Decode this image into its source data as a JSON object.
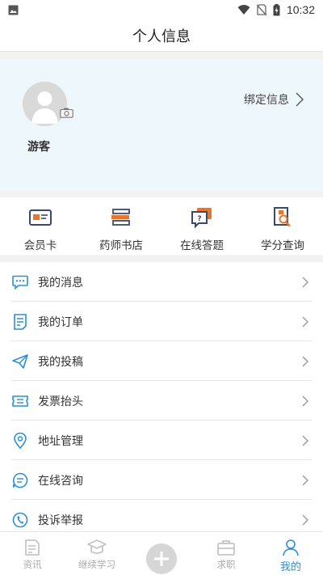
{
  "status_bar": {
    "time": "10:32"
  },
  "header": {
    "title": "个人信息"
  },
  "profile": {
    "name": "游客",
    "bind_label": "绑定信息"
  },
  "quick_actions": [
    {
      "label": "会员卡",
      "icon": "member-card-icon"
    },
    {
      "label": "药师书店",
      "icon": "bookstore-icon"
    },
    {
      "label": "在线答题",
      "icon": "quiz-icon"
    },
    {
      "label": "学分查询",
      "icon": "credit-search-icon"
    }
  ],
  "menu": [
    {
      "label": "我的消息",
      "icon": "message-icon"
    },
    {
      "label": "我的订单",
      "icon": "order-icon"
    },
    {
      "label": "我的投稿",
      "icon": "paper-plane-icon"
    },
    {
      "label": "发票抬头",
      "icon": "invoice-icon"
    },
    {
      "label": "地址管理",
      "icon": "location-icon"
    },
    {
      "label": "在线咨询",
      "icon": "consult-icon"
    },
    {
      "label": "投诉举报",
      "icon": "complaint-icon"
    }
  ],
  "tabbar": [
    {
      "label": "资讯",
      "icon": "news-icon",
      "active": false
    },
    {
      "label": "继续学习",
      "icon": "graduation-cap-icon",
      "active": false
    },
    {
      "label": "",
      "icon": "plus-icon",
      "active": false
    },
    {
      "label": "求职",
      "icon": "briefcase-icon",
      "active": false
    },
    {
      "label": "我的",
      "icon": "person-icon",
      "active": true
    }
  ],
  "colors": {
    "accent": "#2b8fd6",
    "icon_orange": "#e8752c",
    "icon_navy": "#3a4a6b",
    "profile_bg": "#eef7fc"
  }
}
